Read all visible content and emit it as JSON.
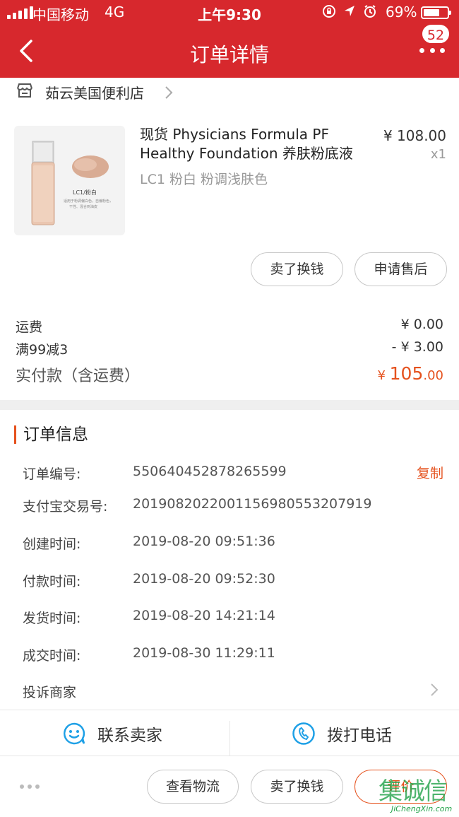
{
  "status_bar": {
    "carrier": "中国移动",
    "network": "4G",
    "time": "上午9:30",
    "battery_percent": "69%",
    "battery_level": 0.69,
    "icons": [
      "lock-rotation-icon",
      "location-arrow-icon",
      "alarm-icon",
      "battery-icon",
      "signal-icon"
    ]
  },
  "navbar": {
    "title": "订单详情",
    "badge_count": "52"
  },
  "shop": {
    "name": "茹云美国便利店"
  },
  "product": {
    "name": "现货 Physicians Formula PF Healthy Foundation 养肤粉底液",
    "price": "¥ 108.00",
    "quantity": "x1",
    "sku": "LC1 粉白 粉调浅肤色",
    "image_label": "LC1/粉白",
    "image_caption": "适用于粉调偏白色，自偏粉色，干性、混合到油皮"
  },
  "item_actions": {
    "sell": "卖了换钱",
    "after_sale": "申请售后"
  },
  "fees": {
    "shipping_label": "运费",
    "shipping_value": "¥ 0.00",
    "discount_label": "满99减3",
    "discount_value": "- ¥ 3.00",
    "total_label": "实付款（含运费）",
    "total_currency": "¥",
    "total_int": "105",
    "total_dec": ".00"
  },
  "order_info": {
    "title": "订单信息",
    "copy_label": "复制",
    "rows": [
      {
        "label": "订单编号:",
        "value": "550640452878265599"
      },
      {
        "label": "支付宝交易号:",
        "value": "2019082022001156980553207919"
      },
      {
        "label": "创建时间:",
        "value": "2019-08-20 09:51:36"
      },
      {
        "label": "付款时间:",
        "value": "2019-08-20 09:52:30"
      },
      {
        "label": "发货时间:",
        "value": "2019-08-20 14:21:14"
      },
      {
        "label": "成交时间:",
        "value": "2019-08-30 11:29:11"
      }
    ],
    "complain": "投诉商家"
  },
  "contact": {
    "seller": "联系卖家",
    "phone": "拨打电话"
  },
  "bottom_actions": {
    "logistics": "查看物流",
    "sell": "卖了换钱",
    "review": "评价"
  },
  "watermark": {
    "text": "集诚信",
    "sub": "JiChengXin.com"
  },
  "colors": {
    "brand_red": "#d7282d",
    "accent_orange": "#e5511d",
    "contact_blue": "#1ea0e6"
  }
}
